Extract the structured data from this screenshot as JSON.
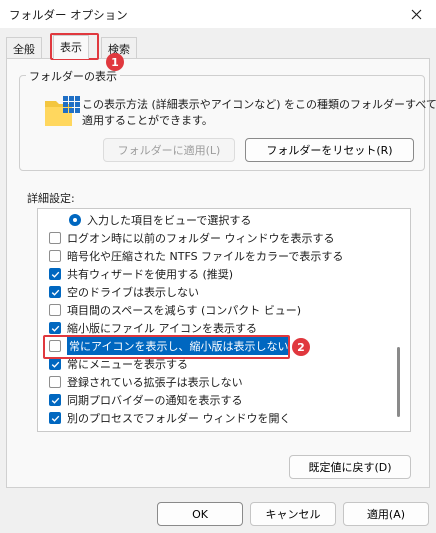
{
  "window": {
    "title": "フォルダー オプション",
    "close_glyph": "✕"
  },
  "tabs": [
    {
      "label": "全般"
    },
    {
      "label": "表示"
    },
    {
      "label": "検索"
    }
  ],
  "folder_views": {
    "legend": "フォルダーの表示",
    "description_line1": "この表示方法 (詳細表示やアイコンなど) をこの種類のフォルダーすべてに",
    "description_line2": "適用することができます。",
    "apply_button": "フォルダーに適用(L)",
    "reset_button": "フォルダーをリセット(R)"
  },
  "advanced": {
    "label": "詳細設定:",
    "items": [
      {
        "type": "radio",
        "checked": true,
        "text": "入力した項目をビューで選択する"
      },
      {
        "type": "checkbox",
        "checked": false,
        "text": "ログオン時に以前のフォルダー ウィンドウを表示する"
      },
      {
        "type": "checkbox",
        "checked": false,
        "text": "暗号化や圧縮された NTFS ファイルをカラーで表示する"
      },
      {
        "type": "checkbox",
        "checked": true,
        "text": "共有ウィザードを使用する (推奨)"
      },
      {
        "type": "checkbox",
        "checked": true,
        "text": "空のドライブは表示しない"
      },
      {
        "type": "checkbox",
        "checked": false,
        "text": "項目間のスペースを減らす (コンパクト ビュー)"
      },
      {
        "type": "checkbox",
        "checked": true,
        "text": "縮小版にファイル アイコンを表示する"
      },
      {
        "type": "checkbox",
        "checked": false,
        "selected": true,
        "text": "常にアイコンを表示し、縮小版は表示しない"
      },
      {
        "type": "checkbox",
        "checked": true,
        "text": "常にメニューを表示する"
      },
      {
        "type": "checkbox",
        "checked": false,
        "text": "登録されている拡張子は表示しない"
      },
      {
        "type": "checkbox",
        "checked": true,
        "text": "同期プロバイダーの通知を表示する"
      },
      {
        "type": "checkbox",
        "checked": true,
        "text": "別のプロセスでフォルダー ウィンドウを開く"
      }
    ]
  },
  "restore_button": "既定値に戻す(D)",
  "footer": {
    "ok": "OK",
    "cancel": "キャンセル",
    "apply": "適用(A)"
  },
  "annotations": {
    "badge1": "1",
    "badge2": "2"
  },
  "colors": {
    "accent": "#0067c0",
    "annotation": "#e0383e"
  }
}
